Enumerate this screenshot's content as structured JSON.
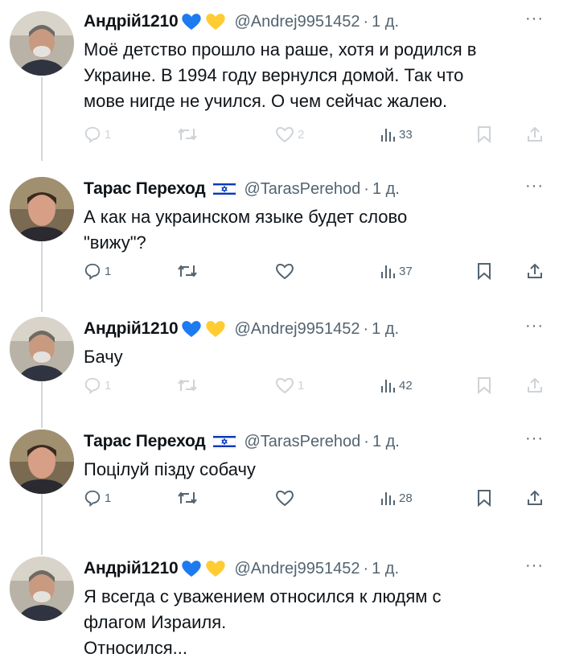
{
  "tweets": [
    {
      "name": "Андрій1210",
      "badges": [
        "blue-heart-icon",
        "yellow-heart-icon"
      ],
      "handle": "@Andrej9951452",
      "time": "1 д.",
      "more": "···",
      "lines": [
        "Моё детство прошло на раше, хотя и родился в",
        "Украине. В 1994 году вернулся домой. Так что",
        "мове нигде не учился. О чем сейчас жалею."
      ],
      "replies": "1",
      "retweets": "",
      "likes": "2",
      "views": "33"
    },
    {
      "name": "Тарас Переход",
      "badges": [
        "israel-flag-icon"
      ],
      "handle": "@TarasPerehod",
      "time": "1 д.",
      "more": "···",
      "lines": [
        "А как на украинском языке будет слово",
        "\"вижу\"?"
      ],
      "replies": "1",
      "retweets": "",
      "likes": "",
      "views": "37"
    },
    {
      "name": "Андрій1210",
      "badges": [
        "blue-heart-icon",
        "yellow-heart-icon"
      ],
      "handle": "@Andrej9951452",
      "time": "1 д.",
      "more": "···",
      "lines": [
        "Бачу"
      ],
      "replies": "1",
      "retweets": "",
      "likes": "1",
      "views": "42"
    },
    {
      "name": "Тарас Переход",
      "badges": [
        "israel-flag-icon"
      ],
      "handle": "@TarasPerehod",
      "time": "1 д.",
      "more": "···",
      "lines": [
        "Поцілуй пізду собачу"
      ],
      "replies": "1",
      "retweets": "",
      "likes": "",
      "views": "28"
    },
    {
      "name": "Андрій1210",
      "badges": [
        "blue-heart-icon",
        "yellow-heart-icon"
      ],
      "handle": "@Andrej9951452",
      "time": "1 д.",
      "more": "···",
      "lines": [
        "Я всегда с уважением относился к людям с",
        "флагом Израиля.",
        "Относился..."
      ]
    }
  ],
  "colors": {
    "text": "#0f1419",
    "muted": "#536471",
    "thread_line": "#cfd9de",
    "heart_blue": "#1d7af0",
    "heart_yellow": "#ffcc33",
    "flag_blue": "#0038b8"
  }
}
